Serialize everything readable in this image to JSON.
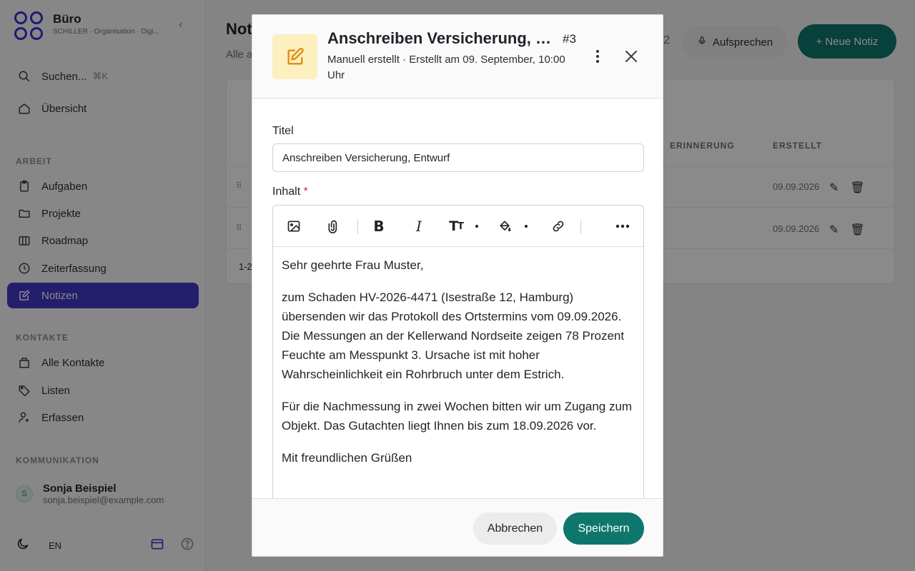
{
  "sidebar": {
    "brand_name": "Büro",
    "brand_sub": "SCHILLER · Organisation · Digi...",
    "search_label": "Suchen...",
    "search_shortcut": "⌘K",
    "overview": "Übersicht",
    "section_work": "ARBEIT",
    "work_items": [
      {
        "label": "Aufgaben",
        "icon": "clipboard-icon"
      },
      {
        "label": "Projekte",
        "icon": "folder-icon"
      },
      {
        "label": "Roadmap",
        "icon": "map-icon"
      },
      {
        "label": "Zeiterfassung",
        "icon": "clock-icon"
      },
      {
        "label": "Notizen",
        "icon": "note-icon",
        "active": true
      }
    ],
    "section_contacts": "KONTAKTE",
    "contact_items": [
      {
        "label": "Alle Kontakte",
        "icon": "building-icon"
      },
      {
        "label": "Listen",
        "icon": "tag-icon"
      },
      {
        "label": "Erfassen",
        "icon": "add-person-icon"
      }
    ],
    "section_communication": "KOMMUNIKATION",
    "user": {
      "initial": "S",
      "name": "Sonja Beispiel",
      "email": "sonja.beispiel@example.com"
    },
    "language": "EN"
  },
  "main": {
    "title": "Not",
    "subtitle": "Alle a",
    "page_count": "2",
    "record_button": "Aufsprechen",
    "new_note_button": "+ Neue Notiz",
    "columns": [
      "ERINNERUNG",
      "ERSTELLT"
    ],
    "rows": [
      {
        "date": "09.09.2026"
      },
      {
        "date": "09.09.2026"
      }
    ],
    "pager": "1-2"
  },
  "modal": {
    "title": "Anschreiben Versicherung, Entwurf",
    "number": "#3",
    "meta": "Manuell erstellt · Erstellt am 09. September, 10:00 Uhr",
    "title_label": "Titel",
    "title_value": "Anschreiben Versicherung, Entwurf",
    "content_label": "Inhalt",
    "required_mark": "*",
    "content_paragraphs": [
      "Sehr geehrte Frau Muster,",
      "zum Schaden HV-2026-4471 (Isestraße 12, Hamburg) übersenden wir das Protokoll des Ortstermins vom 09.09.2026. Die Messungen an der Kellerwand Nordseite zeigen 78 Prozent Feuchte am Messpunkt 3. Ursache ist mit hoher Wahrscheinlichkeit ein Rohrbruch unter dem Estrich.",
      "Für die Nachmessung in zwei Wochen bitten wir um Zugang zum Objekt. Das Gutachten liegt Ihnen bis zum 18.09.2026 vor.",
      "Mit freundlichen Grüßen"
    ],
    "toolbar": {
      "bold": "B",
      "italic": "I",
      "text_size": "T"
    },
    "cancel_button": "Abbrechen",
    "save_button": "Speichern"
  },
  "colors": {
    "accent": "#0f766e",
    "sidebar_active": "#4338ca",
    "note_icon_bg": "#fcefc0",
    "note_icon": "#e08a0e",
    "required": "#dc2626"
  }
}
